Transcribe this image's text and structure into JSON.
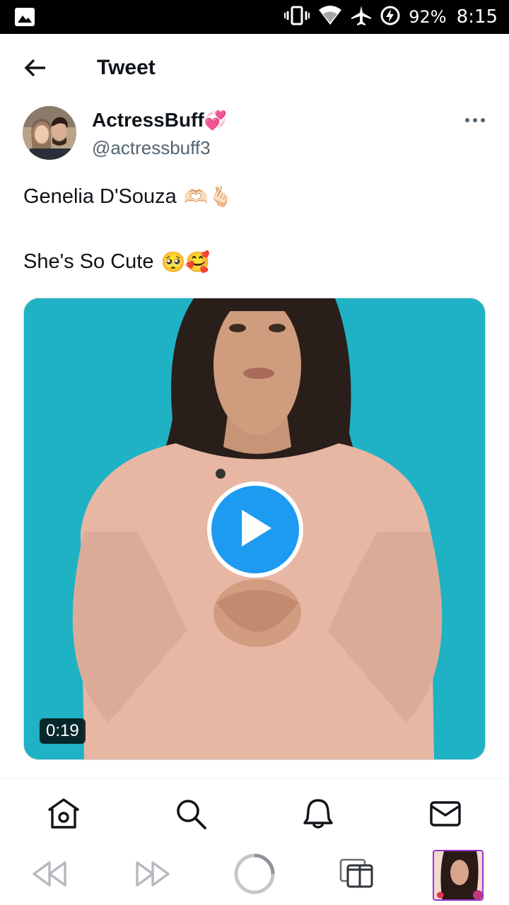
{
  "status_bar": {
    "battery_percent": "92%",
    "time": "8:15",
    "icons": [
      "gallery-icon",
      "vibrate-icon",
      "wifi-icon",
      "airplane-mode-icon",
      "battery-charging-icon"
    ]
  },
  "header": {
    "title": "Tweet",
    "back_icon": "arrow-left-icon"
  },
  "tweet": {
    "author": {
      "display_name": "ActressBuff",
      "name_emoji": "💞",
      "handle": "@actressbuff3"
    },
    "more_icon": "more-horizontal-icon",
    "text_line1": "Genelia D'Souza",
    "text_line1_emoji": "🫶🏻🫰🏻",
    "text_line2": "She's So Cute",
    "text_line2_emoji": "🥺🥰",
    "media": {
      "type": "video",
      "duration": "0:19",
      "play_icon": "play-icon"
    }
  },
  "bottom_nav": {
    "items": [
      {
        "name": "home",
        "icon": "home-icon"
      },
      {
        "name": "search",
        "icon": "search-icon"
      },
      {
        "name": "notifications",
        "icon": "bell-icon"
      },
      {
        "name": "messages",
        "icon": "mail-icon"
      }
    ]
  },
  "controls": {
    "items": [
      "rewind-icon",
      "fast-forward-icon",
      "loading-spinner-icon",
      "tabs-icon",
      "app-thumbnail"
    ]
  },
  "colors": {
    "accent": "#1d9bf0",
    "media_background": "#1fb2c4",
    "handle_gray": "#536471",
    "thumbnail_border": "#9b36c8"
  }
}
